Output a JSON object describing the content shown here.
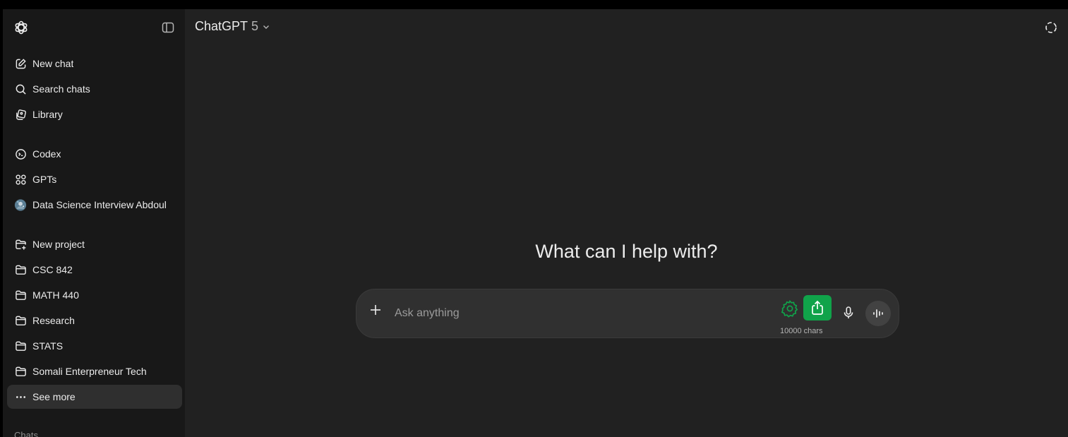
{
  "sidebar": {
    "primary": [
      {
        "label": "New chat",
        "icon": "compose-icon"
      },
      {
        "label": "Search chats",
        "icon": "search-icon"
      },
      {
        "label": "Library",
        "icon": "library-icon"
      }
    ],
    "tools": [
      {
        "label": "Codex",
        "icon": "codex-icon"
      },
      {
        "label": "GPTs",
        "icon": "gpts-grid-icon"
      },
      {
        "label": "Data Science Interview Abdoul",
        "icon": "gpt-avatar"
      }
    ],
    "projects": [
      {
        "label": "New project",
        "icon": "new-folder-icon"
      },
      {
        "label": "CSC 842",
        "icon": "folder-icon"
      },
      {
        "label": "MATH 440",
        "icon": "folder-icon"
      },
      {
        "label": "Research",
        "icon": "folder-icon"
      },
      {
        "label": "STATS",
        "icon": "folder-icon"
      },
      {
        "label": "Somali Enterpreneur Tech",
        "icon": "folder-icon"
      },
      {
        "label": "See more",
        "icon": "more-dots-icon"
      }
    ],
    "chats_label": "Chats"
  },
  "header": {
    "model_name": "ChatGPT",
    "model_version": "5"
  },
  "main": {
    "headline": "What can I help with?",
    "composer": {
      "placeholder": "Ask anything",
      "char_count": "10000 chars"
    }
  },
  "colors": {
    "sidebar_bg": "#181818",
    "main_bg": "#212121",
    "composer_bg": "#303030",
    "accent_green": "#10a34a",
    "active_item_bg": "#2f2f2f"
  }
}
